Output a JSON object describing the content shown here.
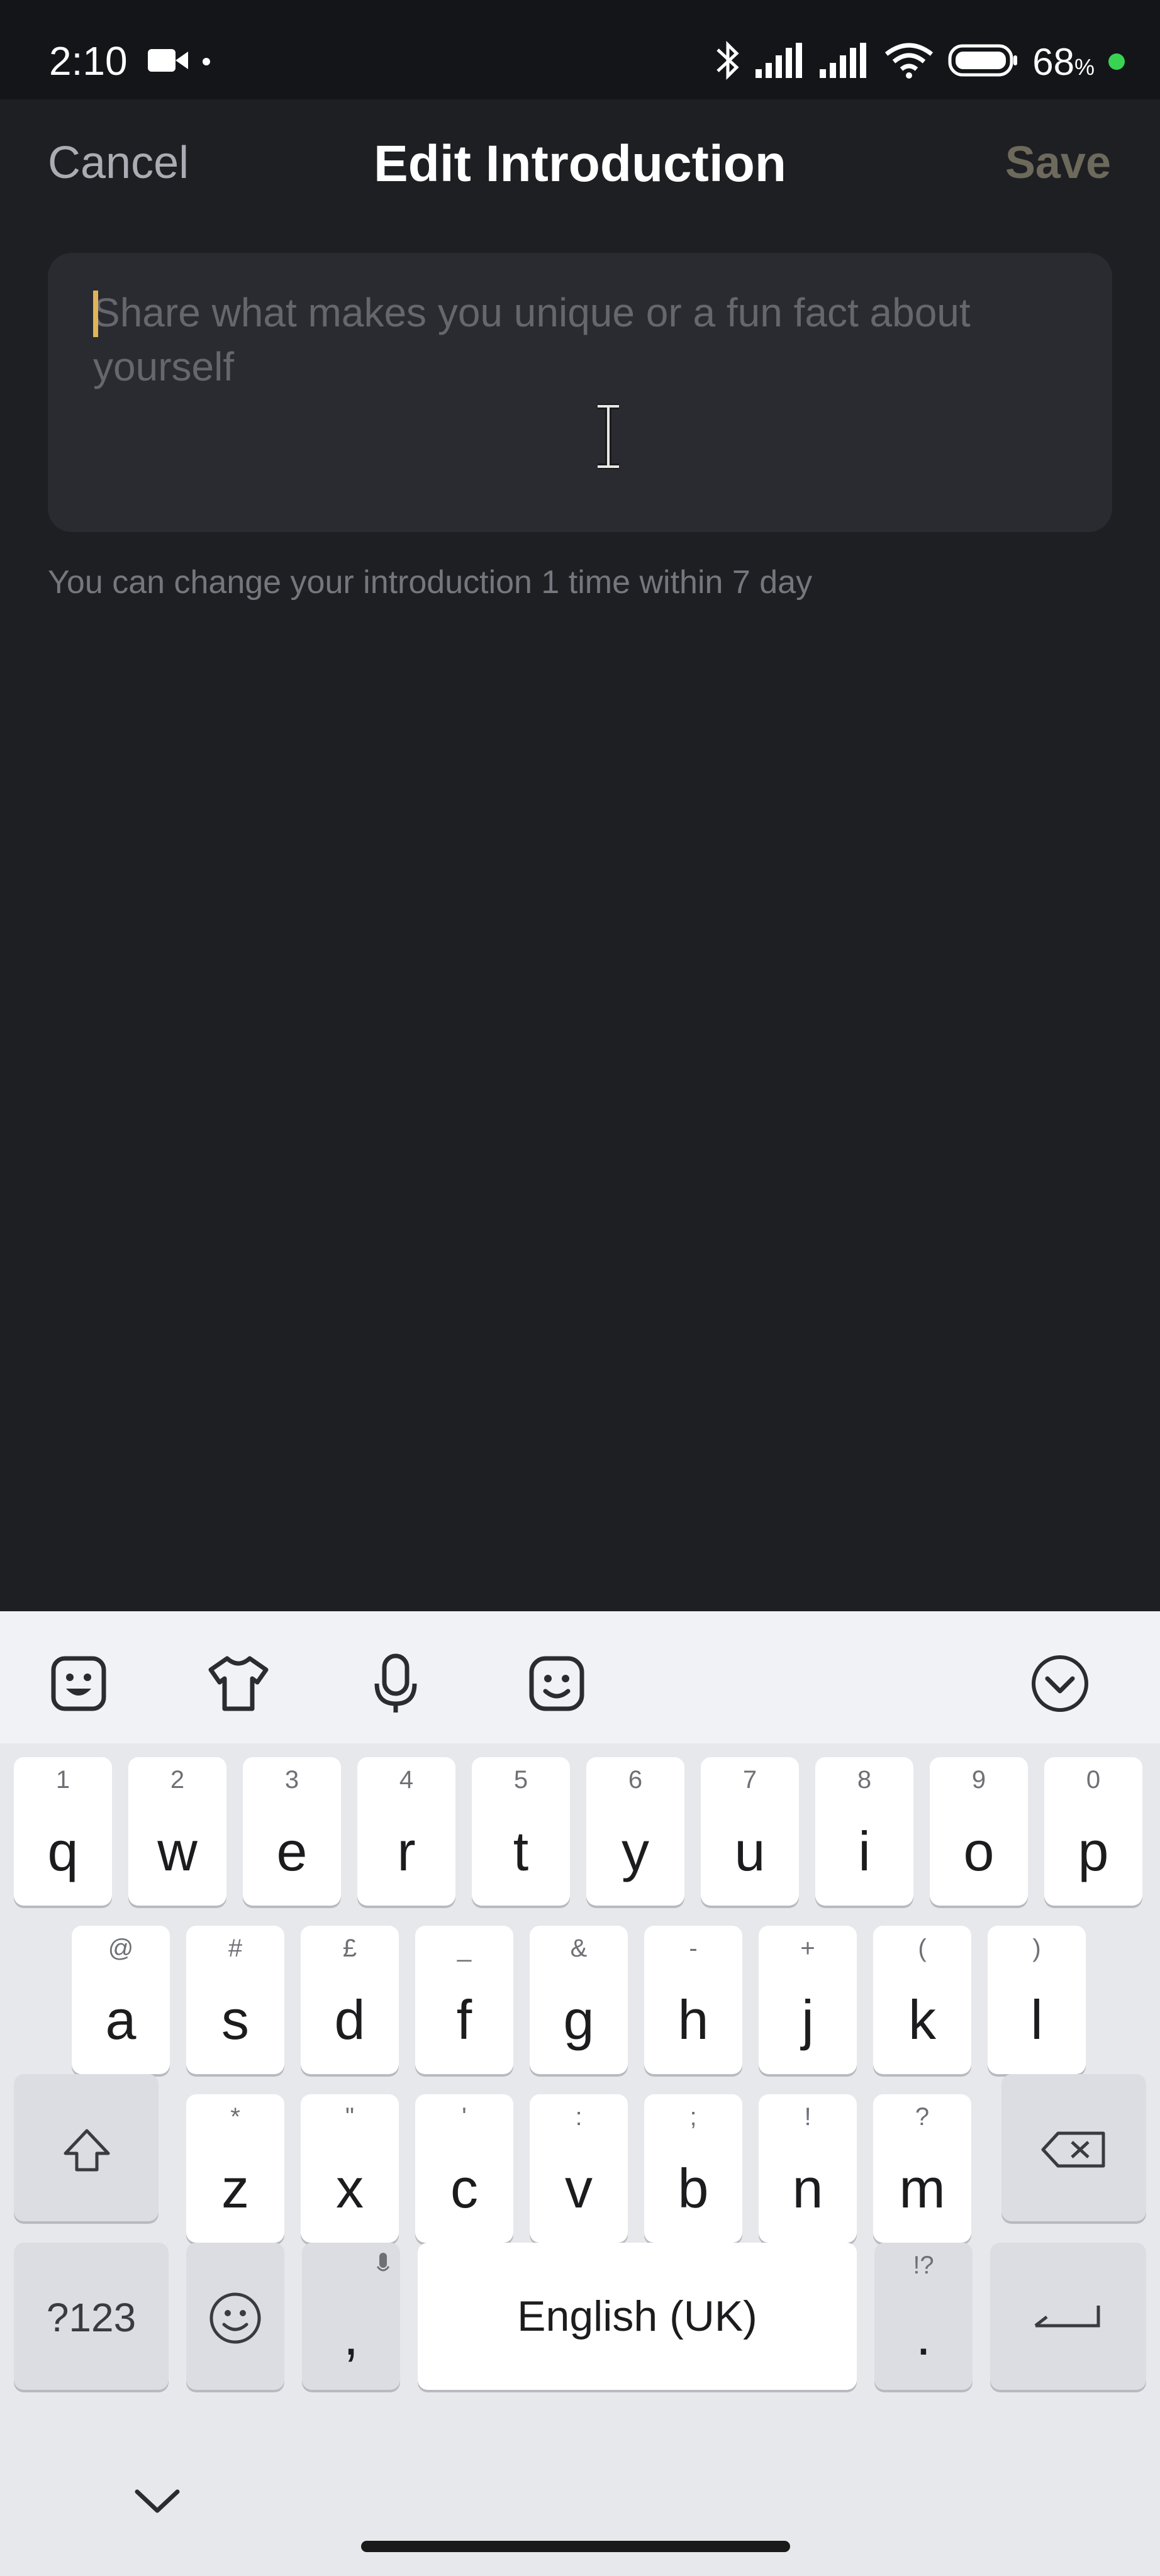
{
  "status_bar": {
    "time": "2:10",
    "battery_percent": "68",
    "battery_unit": "%",
    "icons": [
      "video-camera-icon",
      "bluetooth-icon",
      "signal-icon",
      "signal-icon",
      "wifi-icon",
      "battery-icon"
    ]
  },
  "header": {
    "cancel_label": "Cancel",
    "title": "Edit Introduction",
    "save_label": "Save"
  },
  "intro_input": {
    "value": "",
    "placeholder": "Share what makes you unique or a fun fact about yourself"
  },
  "hint_text": "You can change your introduction 1 time within 7 day",
  "keyboard": {
    "toolbar_icons": [
      "sticker-icon",
      "theme-shirt-icon",
      "microphone-icon",
      "emoji-face-icon",
      "collapse-keyboard-icon"
    ],
    "row1": [
      {
        "key": "q",
        "hint": "1"
      },
      {
        "key": "w",
        "hint": "2"
      },
      {
        "key": "e",
        "hint": "3"
      },
      {
        "key": "r",
        "hint": "4"
      },
      {
        "key": "t",
        "hint": "5"
      },
      {
        "key": "y",
        "hint": "6"
      },
      {
        "key": "u",
        "hint": "7"
      },
      {
        "key": "i",
        "hint": "8"
      },
      {
        "key": "o",
        "hint": "9"
      },
      {
        "key": "p",
        "hint": "0"
      }
    ],
    "row2": [
      {
        "key": "a",
        "hint": "@"
      },
      {
        "key": "s",
        "hint": "#"
      },
      {
        "key": "d",
        "hint": "£"
      },
      {
        "key": "f",
        "hint": "_"
      },
      {
        "key": "g",
        "hint": "&"
      },
      {
        "key": "h",
        "hint": "-"
      },
      {
        "key": "j",
        "hint": "+"
      },
      {
        "key": "k",
        "hint": "("
      },
      {
        "key": "l",
        "hint": ")"
      }
    ],
    "row3": [
      {
        "key": "z",
        "hint": "*"
      },
      {
        "key": "x",
        "hint": "\""
      },
      {
        "key": "c",
        "hint": "'"
      },
      {
        "key": "v",
        "hint": ":"
      },
      {
        "key": "b",
        "hint": ";"
      },
      {
        "key": "n",
        "hint": "!"
      },
      {
        "key": "m",
        "hint": "?"
      }
    ],
    "symbols_label": "?123",
    "comma_label": ",",
    "space_label": "English (UK)",
    "period_label": ".",
    "period_hint": "!?"
  },
  "colors": {
    "background": "#1e1f23",
    "accent_caret": "#e0b55a",
    "save_disabled": "#6d6a5c",
    "battery_dot": "#39d353"
  }
}
